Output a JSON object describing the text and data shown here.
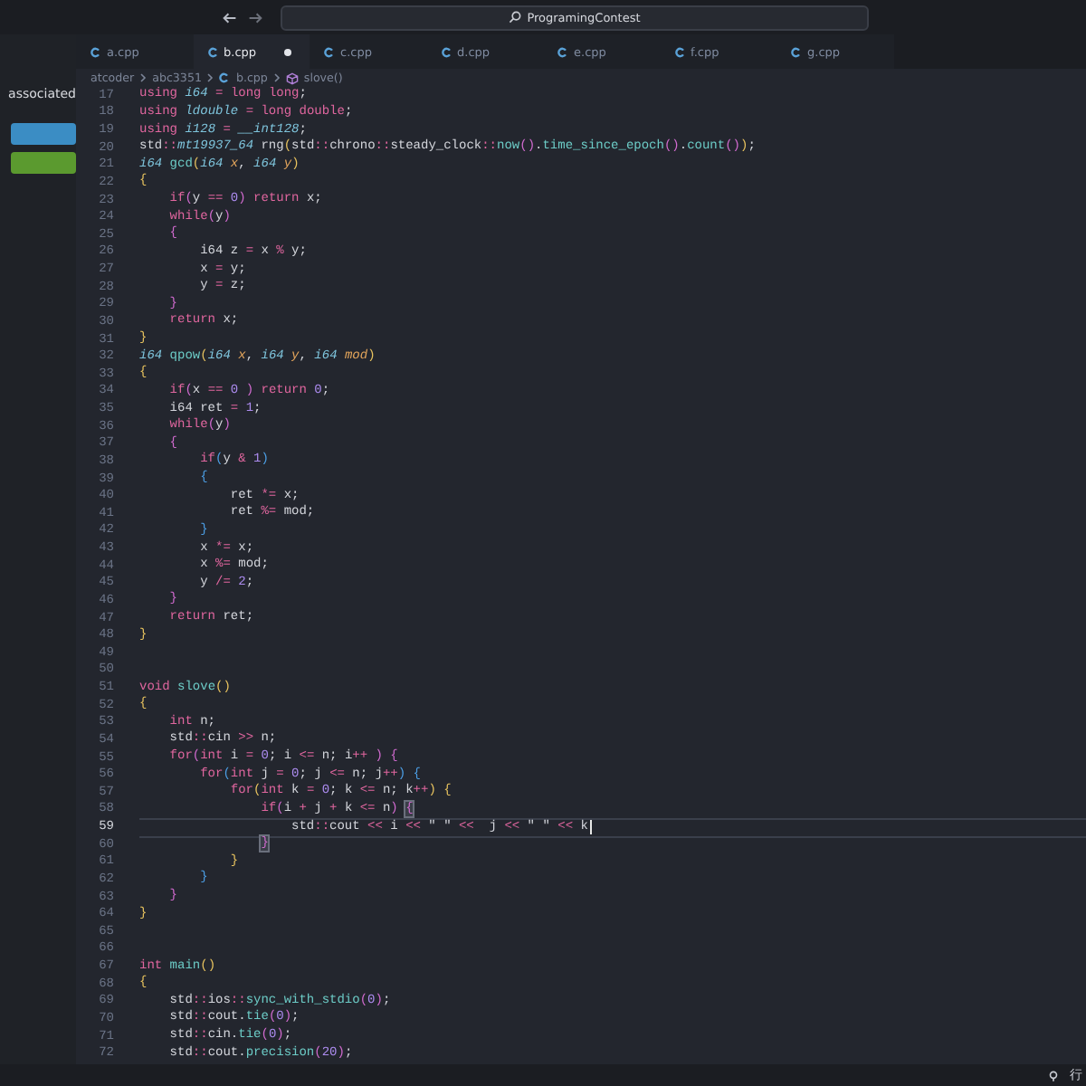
{
  "titlebar": {
    "search": "ProgramingContest"
  },
  "sidebar": {
    "text": "associated",
    "buttons": [
      {
        "color": "#3b8dc4"
      },
      {
        "color": "#5b9a2f"
      }
    ]
  },
  "tabs": [
    {
      "label": "a.cpp",
      "selected": false,
      "modified": false
    },
    {
      "label": "b.cpp",
      "selected": true,
      "modified": true
    },
    {
      "label": "c.cpp",
      "selected": false,
      "modified": false
    },
    {
      "label": "d.cpp",
      "selected": false,
      "modified": false
    },
    {
      "label": "e.cpp",
      "selected": false,
      "modified": false
    },
    {
      "label": "f.cpp",
      "selected": false,
      "modified": false
    },
    {
      "label": "g.cpp",
      "selected": false,
      "modified": false
    }
  ],
  "breadcrumbs": [
    {
      "kind": "folder",
      "label": "atcoder"
    },
    {
      "kind": "folder",
      "label": "abc3351"
    },
    {
      "kind": "file",
      "label": "b.cpp"
    },
    {
      "kind": "symbol",
      "label": "slove()"
    }
  ],
  "lines": [
    {
      "number": "17",
      "active": false,
      "tokens": [
        {
          "kind": "k",
          "text": "using "
        },
        {
          "kind": "t",
          "text": "i64"
        },
        {
          "kind": "o",
          "text": " = "
        },
        {
          "kind": "k",
          "text": "long long"
        },
        {
          "kind": "p",
          "text": ";"
        }
      ]
    },
    {
      "number": "18",
      "active": false,
      "tokens": [
        {
          "kind": "k",
          "text": "using "
        },
        {
          "kind": "t",
          "text": "ldouble"
        },
        {
          "kind": "o",
          "text": " = "
        },
        {
          "kind": "k",
          "text": "long double"
        },
        {
          "kind": "p",
          "text": ";"
        }
      ]
    },
    {
      "number": "19",
      "active": false,
      "tokens": [
        {
          "kind": "k",
          "text": "using "
        },
        {
          "kind": "t",
          "text": "i128"
        },
        {
          "kind": "o",
          "text": " = "
        },
        {
          "kind": "t",
          "text": "__int128"
        },
        {
          "kind": "p",
          "text": ";"
        }
      ]
    },
    {
      "number": "20",
      "active": false,
      "tokens": [
        {
          "kind": "p",
          "text": "std"
        },
        {
          "kind": "o",
          "text": "::"
        },
        {
          "kind": "t",
          "text": "mt19937_64"
        },
        {
          "kind": "p",
          "text": " rng"
        },
        {
          "kind": "y",
          "text": "("
        },
        {
          "kind": "p",
          "text": "std"
        },
        {
          "kind": "o",
          "text": "::"
        },
        {
          "kind": "p",
          "text": "chrono"
        },
        {
          "kind": "o",
          "text": "::"
        },
        {
          "kind": "p",
          "text": "steady_clock"
        },
        {
          "kind": "o",
          "text": "::"
        },
        {
          "kind": "f",
          "text": "now"
        },
        {
          "kind": "m",
          "text": "()"
        },
        {
          "kind": "p",
          "text": "."
        },
        {
          "kind": "f",
          "text": "time_since_epoch"
        },
        {
          "kind": "m",
          "text": "()"
        },
        {
          "kind": "p",
          "text": "."
        },
        {
          "kind": "f",
          "text": "count"
        },
        {
          "kind": "m",
          "text": "()"
        },
        {
          "kind": "y",
          "text": ")"
        },
        {
          "kind": "p",
          "text": ";"
        }
      ]
    },
    {
      "number": "21",
      "active": false,
      "tokens": [
        {
          "kind": "t",
          "text": "i64"
        },
        {
          "kind": "f",
          "text": " gcd"
        },
        {
          "kind": "y",
          "text": "("
        },
        {
          "kind": "t",
          "text": "i64"
        },
        {
          "kind": "v",
          "text": " x"
        },
        {
          "kind": "p",
          "text": ", "
        },
        {
          "kind": "t",
          "text": "i64"
        },
        {
          "kind": "v",
          "text": " y"
        },
        {
          "kind": "y",
          "text": ")"
        }
      ]
    },
    {
      "number": "22",
      "active": false,
      "tokens": [
        {
          "kind": "y",
          "text": "{"
        }
      ]
    },
    {
      "number": "23",
      "active": false,
      "tokens": [
        {
          "kind": "k",
          "text": "    if"
        },
        {
          "kind": "m",
          "text": "("
        },
        {
          "kind": "p",
          "text": "y "
        },
        {
          "kind": "o",
          "text": "=="
        },
        {
          "kind": "n",
          "text": " 0"
        },
        {
          "kind": "m",
          "text": ")"
        },
        {
          "kind": "k",
          "text": " return"
        },
        {
          "kind": "p",
          "text": " x;"
        }
      ]
    },
    {
      "number": "24",
      "active": false,
      "tokens": [
        {
          "kind": "k",
          "text": "    while"
        },
        {
          "kind": "m",
          "text": "("
        },
        {
          "kind": "p",
          "text": "y"
        },
        {
          "kind": "m",
          "text": ")"
        }
      ]
    },
    {
      "number": "25",
      "active": false,
      "tokens": [
        {
          "kind": "m",
          "text": "    {"
        }
      ]
    },
    {
      "number": "26",
      "active": false,
      "tokens": [
        {
          "kind": "p",
          "text": "        i64 z "
        },
        {
          "kind": "o",
          "text": "="
        },
        {
          "kind": "p",
          "text": " x "
        },
        {
          "kind": "o",
          "text": "%"
        },
        {
          "kind": "p",
          "text": " y;"
        }
      ]
    },
    {
      "number": "27",
      "active": false,
      "tokens": [
        {
          "kind": "p",
          "text": "        x "
        },
        {
          "kind": "o",
          "text": "="
        },
        {
          "kind": "p",
          "text": " y;"
        }
      ]
    },
    {
      "number": "28",
      "active": false,
      "tokens": [
        {
          "kind": "p",
          "text": "        y "
        },
        {
          "kind": "o",
          "text": "="
        },
        {
          "kind": "p",
          "text": " z;"
        }
      ]
    },
    {
      "number": "29",
      "active": false,
      "tokens": [
        {
          "kind": "m",
          "text": "    }"
        }
      ]
    },
    {
      "number": "30",
      "active": false,
      "tokens": [
        {
          "kind": "k",
          "text": "    return"
        },
        {
          "kind": "p",
          "text": " x;"
        }
      ]
    },
    {
      "number": "31",
      "active": false,
      "tokens": [
        {
          "kind": "y",
          "text": "}"
        }
      ]
    },
    {
      "number": "32",
      "active": false,
      "tokens": [
        {
          "kind": "t",
          "text": "i64"
        },
        {
          "kind": "f",
          "text": " qpow"
        },
        {
          "kind": "y",
          "text": "("
        },
        {
          "kind": "t",
          "text": "i64"
        },
        {
          "kind": "v",
          "text": " x"
        },
        {
          "kind": "p",
          "text": ", "
        },
        {
          "kind": "t",
          "text": "i64"
        },
        {
          "kind": "v",
          "text": " y"
        },
        {
          "kind": "p",
          "text": ", "
        },
        {
          "kind": "t",
          "text": "i64"
        },
        {
          "kind": "v",
          "text": " mod"
        },
        {
          "kind": "y",
          "text": ")"
        }
      ]
    },
    {
      "number": "33",
      "active": false,
      "tokens": [
        {
          "kind": "y",
          "text": "{"
        }
      ]
    },
    {
      "number": "34",
      "active": false,
      "tokens": [
        {
          "kind": "k",
          "text": "    if"
        },
        {
          "kind": "m",
          "text": "("
        },
        {
          "kind": "p",
          "text": "x "
        },
        {
          "kind": "o",
          "text": "=="
        },
        {
          "kind": "n",
          "text": " 0"
        },
        {
          "kind": "m",
          "text": " )"
        },
        {
          "kind": "k",
          "text": " return"
        },
        {
          "kind": "n",
          "text": " 0"
        },
        {
          "kind": "p",
          "text": ";"
        }
      ]
    },
    {
      "number": "35",
      "active": false,
      "tokens": [
        {
          "kind": "p",
          "text": "    i64 ret "
        },
        {
          "kind": "o",
          "text": "="
        },
        {
          "kind": "n",
          "text": " 1"
        },
        {
          "kind": "p",
          "text": ";"
        }
      ]
    },
    {
      "number": "36",
      "active": false,
      "tokens": [
        {
          "kind": "k",
          "text": "    while"
        },
        {
          "kind": "m",
          "text": "("
        },
        {
          "kind": "p",
          "text": "y"
        },
        {
          "kind": "m",
          "text": ")"
        }
      ]
    },
    {
      "number": "37",
      "active": false,
      "tokens": [
        {
          "kind": "m",
          "text": "    {"
        }
      ]
    },
    {
      "number": "38",
      "active": false,
      "tokens": [
        {
          "kind": "k",
          "text": "        if"
        },
        {
          "kind": "c",
          "text": "("
        },
        {
          "kind": "p",
          "text": "y "
        },
        {
          "kind": "o",
          "text": "&"
        },
        {
          "kind": "n",
          "text": " 1"
        },
        {
          "kind": "c",
          "text": ")"
        }
      ]
    },
    {
      "number": "39",
      "active": false,
      "tokens": [
        {
          "kind": "c",
          "text": "        {"
        }
      ]
    },
    {
      "number": "40",
      "active": false,
      "tokens": [
        {
          "kind": "p",
          "text": "            ret "
        },
        {
          "kind": "o",
          "text": "*="
        },
        {
          "kind": "p",
          "text": " x;"
        }
      ]
    },
    {
      "number": "41",
      "active": false,
      "tokens": [
        {
          "kind": "p",
          "text": "            ret "
        },
        {
          "kind": "o",
          "text": "%="
        },
        {
          "kind": "p",
          "text": " mod;"
        }
      ]
    },
    {
      "number": "42",
      "active": false,
      "tokens": [
        {
          "kind": "c",
          "text": "        }"
        }
      ]
    },
    {
      "number": "43",
      "active": false,
      "tokens": [
        {
          "kind": "p",
          "text": "        x "
        },
        {
          "kind": "o",
          "text": "*="
        },
        {
          "kind": "p",
          "text": " x;"
        }
      ]
    },
    {
      "number": "44",
      "active": false,
      "tokens": [
        {
          "kind": "p",
          "text": "        x "
        },
        {
          "kind": "o",
          "text": "%="
        },
        {
          "kind": "p",
          "text": " mod;"
        }
      ]
    },
    {
      "number": "45",
      "active": false,
      "tokens": [
        {
          "kind": "p",
          "text": "        y "
        },
        {
          "kind": "o",
          "text": "/="
        },
        {
          "kind": "n",
          "text": " 2"
        },
        {
          "kind": "p",
          "text": ";"
        }
      ]
    },
    {
      "number": "46",
      "active": false,
      "tokens": [
        {
          "kind": "m",
          "text": "    }"
        }
      ]
    },
    {
      "number": "47",
      "active": false,
      "tokens": [
        {
          "kind": "k",
          "text": "    return"
        },
        {
          "kind": "p",
          "text": " ret;"
        }
      ]
    },
    {
      "number": "48",
      "active": false,
      "tokens": [
        {
          "kind": "y",
          "text": "}"
        }
      ]
    },
    {
      "number": "49",
      "active": false
    },
    {
      "number": "50",
      "active": false
    },
    {
      "number": "51",
      "active": false,
      "tokens": [
        {
          "kind": "k",
          "text": "void"
        },
        {
          "kind": "f",
          "text": " slove"
        },
        {
          "kind": "y",
          "text": "()"
        }
      ]
    },
    {
      "number": "52",
      "active": false,
      "tokens": [
        {
          "kind": "y",
          "text": "{"
        }
      ]
    },
    {
      "number": "53",
      "active": false,
      "tokens": [
        {
          "kind": "k",
          "text": "    int"
        },
        {
          "kind": "p",
          "text": " n;"
        }
      ]
    },
    {
      "number": "54",
      "active": false,
      "tokens": [
        {
          "kind": "p",
          "text": "    std"
        },
        {
          "kind": "o",
          "text": "::"
        },
        {
          "kind": "p",
          "text": "cin "
        },
        {
          "kind": "o",
          "text": ">>"
        },
        {
          "kind": "p",
          "text": " n;"
        }
      ]
    },
    {
      "number": "55",
      "active": false,
      "tokens": [
        {
          "kind": "k",
          "text": "    for"
        },
        {
          "kind": "m",
          "text": "("
        },
        {
          "kind": "k",
          "text": "int"
        },
        {
          "kind": "p",
          "text": " i "
        },
        {
          "kind": "o",
          "text": "="
        },
        {
          "kind": "n",
          "text": " 0"
        },
        {
          "kind": "p",
          "text": "; i "
        },
        {
          "kind": "o",
          "text": "<="
        },
        {
          "kind": "p",
          "text": " n; i"
        },
        {
          "kind": "o",
          "text": "++"
        },
        {
          "kind": "m",
          "text": " )"
        },
        {
          "kind": "m",
          "text": " {"
        }
      ]
    },
    {
      "number": "56",
      "active": false,
      "tokens": [
        {
          "kind": "k",
          "text": "        for"
        },
        {
          "kind": "c",
          "text": "("
        },
        {
          "kind": "k",
          "text": "int"
        },
        {
          "kind": "p",
          "text": " j "
        },
        {
          "kind": "o",
          "text": "="
        },
        {
          "kind": "n",
          "text": " 0"
        },
        {
          "kind": "p",
          "text": "; j "
        },
        {
          "kind": "o",
          "text": "<="
        },
        {
          "kind": "p",
          "text": " n; j"
        },
        {
          "kind": "o",
          "text": "++"
        },
        {
          "kind": "c",
          "text": ")"
        },
        {
          "kind": "c",
          "text": " {"
        }
      ]
    },
    {
      "number": "57",
      "active": false,
      "tokens": [
        {
          "kind": "k",
          "text": "            for"
        },
        {
          "kind": "y",
          "text": "("
        },
        {
          "kind": "k",
          "text": "int"
        },
        {
          "kind": "p",
          "text": " k "
        },
        {
          "kind": "o",
          "text": "="
        },
        {
          "kind": "n",
          "text": " 0"
        },
        {
          "kind": "p",
          "text": "; k "
        },
        {
          "kind": "o",
          "text": "<="
        },
        {
          "kind": "p",
          "text": " n; k"
        },
        {
          "kind": "o",
          "text": "++"
        },
        {
          "kind": "y",
          "text": ")"
        },
        {
          "kind": "y",
          "text": " {"
        }
      ]
    },
    {
      "number": "58",
      "active": false,
      "tokens": [
        {
          "kind": "k",
          "text": "                if"
        },
        {
          "kind": "m",
          "text": "("
        },
        {
          "kind": "p",
          "text": "i "
        },
        {
          "kind": "o",
          "text": "+"
        },
        {
          "kind": "p",
          "text": " j "
        },
        {
          "kind": "o",
          "text": "+"
        },
        {
          "kind": "p",
          "text": " k "
        },
        {
          "kind": "o",
          "text": "<="
        },
        {
          "kind": "p",
          "text": " n"
        },
        {
          "kind": "m",
          "text": ") "
        },
        {
          "kind": "bm",
          "text": "{"
        }
      ]
    },
    {
      "number": "59",
      "active": true,
      "tokens": [
        {
          "kind": "p",
          "text": "                    std"
        },
        {
          "kind": "o",
          "text": "::"
        },
        {
          "kind": "p",
          "text": "cout "
        },
        {
          "kind": "o",
          "text": "<<"
        },
        {
          "kind": "p",
          "text": " i "
        },
        {
          "kind": "o",
          "text": "<<"
        },
        {
          "kind": "s",
          "text": " \" \" "
        },
        {
          "kind": "o",
          "text": "<<"
        },
        {
          "kind": "p",
          "text": "  j "
        },
        {
          "kind": "o",
          "text": "<<"
        },
        {
          "kind": "s",
          "text": " \" \" "
        },
        {
          "kind": "o",
          "text": "<<"
        },
        {
          "kind": "p",
          "text": " k"
        }
      ]
    },
    {
      "number": "60",
      "active": false,
      "tokens": [
        {
          "kind": "bm",
          "text": "                }"
        }
      ]
    },
    {
      "number": "61",
      "active": false,
      "tokens": [
        {
          "kind": "y",
          "text": "            }"
        }
      ]
    },
    {
      "number": "62",
      "active": false,
      "tokens": [
        {
          "kind": "c",
          "text": "        }"
        }
      ]
    },
    {
      "number": "63",
      "active": false,
      "tokens": [
        {
          "kind": "m",
          "text": "    }"
        }
      ]
    },
    {
      "number": "64",
      "active": false,
      "tokens": [
        {
          "kind": "y",
          "text": "}"
        }
      ]
    },
    {
      "number": "65",
      "active": false
    },
    {
      "number": "66",
      "active": false
    },
    {
      "number": "67",
      "active": false,
      "tokens": [
        {
          "kind": "k",
          "text": "int"
        },
        {
          "kind": "f",
          "text": " main"
        },
        {
          "kind": "y",
          "text": "()"
        }
      ]
    },
    {
      "number": "68",
      "active": false,
      "tokens": [
        {
          "kind": "y",
          "text": "{"
        }
      ]
    },
    {
      "number": "69",
      "active": false,
      "tokens": [
        {
          "kind": "p",
          "text": "    std"
        },
        {
          "kind": "o",
          "text": "::"
        },
        {
          "kind": "p",
          "text": "ios"
        },
        {
          "kind": "o",
          "text": "::"
        },
        {
          "kind": "f",
          "text": "sync_with_stdio"
        },
        {
          "kind": "m",
          "text": "("
        },
        {
          "kind": "n",
          "text": "0"
        },
        {
          "kind": "m",
          "text": ")"
        },
        {
          "kind": "p",
          "text": ";"
        }
      ]
    },
    {
      "number": "70",
      "active": false,
      "tokens": [
        {
          "kind": "p",
          "text": "    std"
        },
        {
          "kind": "o",
          "text": "::"
        },
        {
          "kind": "p",
          "text": "cout."
        },
        {
          "kind": "f",
          "text": "tie"
        },
        {
          "kind": "m",
          "text": "("
        },
        {
          "kind": "n",
          "text": "0"
        },
        {
          "kind": "m",
          "text": ")"
        },
        {
          "kind": "p",
          "text": ";"
        }
      ]
    },
    {
      "number": "71",
      "active": false,
      "tokens": [
        {
          "kind": "p",
          "text": "    std"
        },
        {
          "kind": "o",
          "text": "::"
        },
        {
          "kind": "p",
          "text": "cin."
        },
        {
          "kind": "f",
          "text": "tie"
        },
        {
          "kind": "m",
          "text": "("
        },
        {
          "kind": "n",
          "text": "0"
        },
        {
          "kind": "m",
          "text": ")"
        },
        {
          "kind": "p",
          "text": ";"
        }
      ]
    },
    {
      "number": "72",
      "active": false,
      "tokens": [
        {
          "kind": "p",
          "text": "    std"
        },
        {
          "kind": "o",
          "text": "::"
        },
        {
          "kind": "p",
          "text": "cout."
        },
        {
          "kind": "f",
          "text": "precision"
        },
        {
          "kind": "m",
          "text": "("
        },
        {
          "kind": "n",
          "text": "20"
        },
        {
          "kind": "m",
          "text": ")"
        },
        {
          "kind": "p",
          "text": ";"
        }
      ]
    }
  ],
  "status_bar": {
    "text": "行"
  }
}
